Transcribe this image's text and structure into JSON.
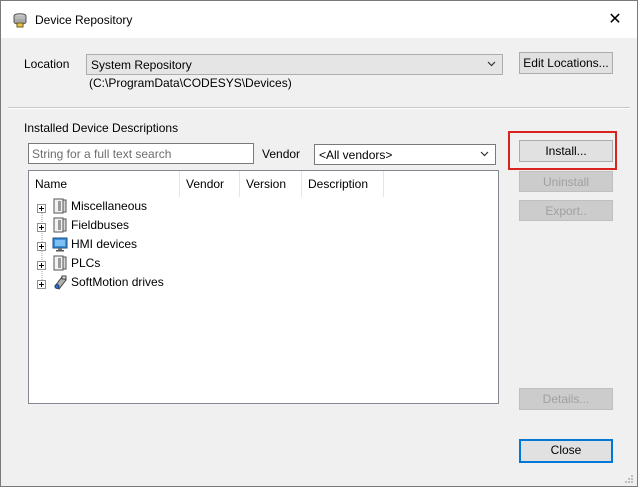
{
  "window": {
    "title": "Device Repository",
    "close_glyph": "✕",
    "icon": "device-repository-icon"
  },
  "location": {
    "label": "Location",
    "selected": "System Repository",
    "path": "(C:\\ProgramData\\CODESYS\\Devices)",
    "edit_button": "Edit Locations..."
  },
  "installed": {
    "heading": "Installed Device Descriptions",
    "search_placeholder": "String for a full text search",
    "search_value": "",
    "vendor_label": "Vendor",
    "vendor_selected": "<All vendors>"
  },
  "tree": {
    "columns": [
      "Name",
      "Vendor",
      "Version",
      "Description"
    ],
    "items": [
      {
        "label": "Miscellaneous",
        "icon": "device-icon"
      },
      {
        "label": "Fieldbuses",
        "icon": "device-icon"
      },
      {
        "label": "HMI devices",
        "icon": "monitor-icon"
      },
      {
        "label": "PLCs",
        "icon": "device-icon"
      },
      {
        "label": "SoftMotion drives",
        "icon": "softmotion-drive-icon"
      }
    ]
  },
  "buttons": {
    "install": "Install...",
    "uninstall": "Uninstall",
    "export": "Export..",
    "details": "Details...",
    "close": "Close"
  },
  "colors": {
    "highlight": "#d9231f",
    "default_button_border": "#0078d7"
  }
}
